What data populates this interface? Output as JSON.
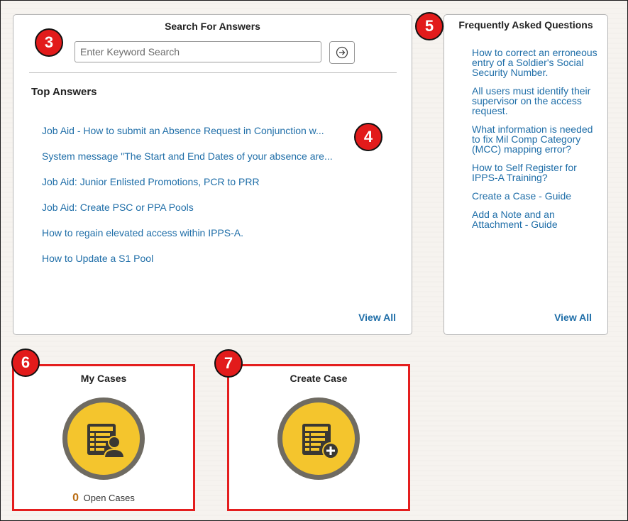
{
  "search": {
    "title": "Search For Answers",
    "placeholder": "Enter Keyword Search",
    "go_icon": "arrow-circle-right-icon"
  },
  "top_answers": {
    "heading": "Top Answers",
    "items": [
      "Job Aid - How to submit an Absence Request in Conjunction w...",
      "System message \"The Start and End Dates of your absence are...",
      "Job Aid: Junior Enlisted Promotions, PCR to PRR",
      "Job Aid: Create PSC or PPA Pools",
      "How to regain elevated access within IPPS-A.",
      "How to Update a S1 Pool"
    ],
    "view_all": "View All"
  },
  "faq": {
    "title": "Frequently Asked Questions",
    "items": [
      "How to correct an erroneous entry of a Soldier's Social Security Number.",
      "All users must identify their supervisor on the access request.",
      "What information is needed to fix Mil Comp Category (MCC) mapping error?",
      "How to Self Register for IPPS-A Training?",
      "Create a Case - Guide",
      "Add a Note and an Attachment - Guide"
    ],
    "view_all": "View All"
  },
  "my_cases": {
    "title": "My Cases",
    "icon": "case-list-user-icon",
    "count": "0",
    "count_label": "Open Cases"
  },
  "create_case": {
    "title": "Create Case",
    "icon": "case-list-add-icon"
  },
  "callouts": [
    "3",
    "4",
    "5",
    "6",
    "7"
  ],
  "colors": {
    "link": "#1f6ea8",
    "callout_red": "#e21b1b",
    "icon_yellow": "#f4c52d",
    "icon_ring": "#6f6b62",
    "count_orange": "#b96c12",
    "highlight_border": "#e41e1e"
  }
}
